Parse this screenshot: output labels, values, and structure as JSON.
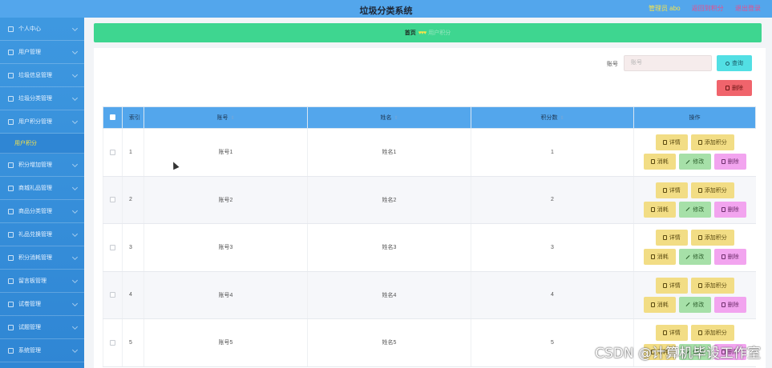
{
  "header": {
    "title": "垃圾分类系统",
    "admin_label": "管理员 abo",
    "link_1": "返回到积分",
    "link_2": "退出登录"
  },
  "sidebar": {
    "items": [
      {
        "label": "个人中心",
        "icon": "user-icon"
      },
      {
        "label": "用户管理",
        "icon": "users-icon"
      },
      {
        "label": "垃圾信息管理",
        "icon": "trash-icon"
      },
      {
        "label": "垃圾分类管理",
        "icon": "category-icon"
      },
      {
        "label": "用户积分管理",
        "icon": "points-icon"
      },
      {
        "label": "积分增加管理",
        "icon": "plus-icon"
      },
      {
        "label": "商城礼品管理",
        "icon": "gift-icon"
      },
      {
        "label": "商品分类管理",
        "icon": "tag-icon"
      },
      {
        "label": "礼品兑换管理",
        "icon": "exchange-icon"
      },
      {
        "label": "积分消耗管理",
        "icon": "minus-icon"
      },
      {
        "label": "留言板管理",
        "icon": "message-icon"
      },
      {
        "label": "试卷管理",
        "icon": "paper-icon"
      },
      {
        "label": "试题管理",
        "icon": "question-icon"
      },
      {
        "label": "系统管理",
        "icon": "settings-icon"
      }
    ],
    "sub_item": "用户积分"
  },
  "breadcrumb": {
    "home": "首页",
    "separator": "♥♥♥",
    "current": "用户积分"
  },
  "search": {
    "label": "账号",
    "placeholder": "账号",
    "query_label": "查询",
    "delete_label": "删除"
  },
  "table": {
    "columns": [
      "索引",
      "账号",
      "姓名",
      "积分数",
      "操作"
    ],
    "rows": [
      {
        "index": "1",
        "account": "账号1",
        "name": "姓名1",
        "points": "1"
      },
      {
        "index": "2",
        "account": "账号2",
        "name": "姓名2",
        "points": "2"
      },
      {
        "index": "3",
        "account": "账号3",
        "name": "姓名3",
        "points": "3"
      },
      {
        "index": "4",
        "account": "账号4",
        "name": "姓名4",
        "points": "4"
      },
      {
        "index": "5",
        "account": "账号5",
        "name": "姓名5",
        "points": "5"
      }
    ],
    "actions": {
      "detail": "详情",
      "add_points": "添加积分",
      "consume": "消耗",
      "edit": "修改",
      "delete": "删除"
    }
  },
  "watermark": "CSDN @计算机毕设工作室"
}
